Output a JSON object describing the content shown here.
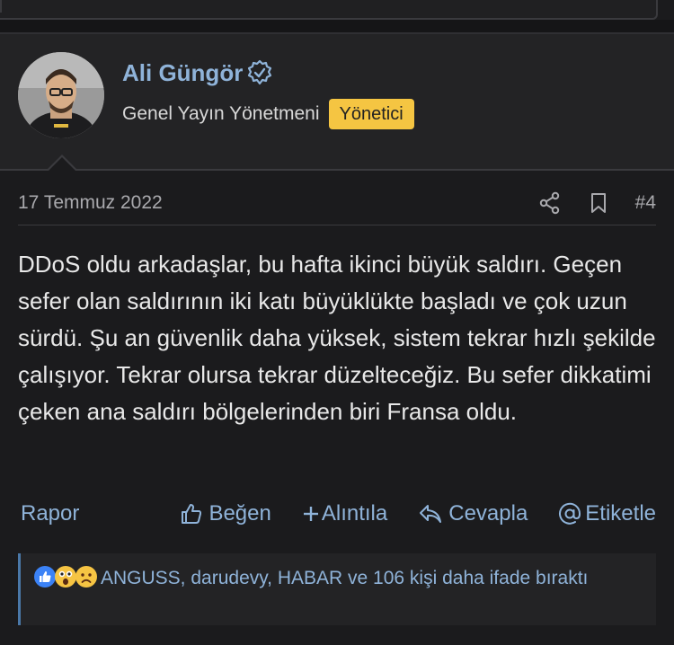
{
  "user": {
    "name": "Ali Güngör",
    "title": "Genel Yayın Yönetmeni",
    "role_badge": "Yönetici"
  },
  "post": {
    "date": "17 Temmuz 2022",
    "number": "#4",
    "body": "DDoS oldu arkadaşlar, bu hafta ikinci büyük saldırı. Geçen sefer olan saldırının iki katı büyüklükte başladı ve çok uzun sürdü. Şu an güvenlik daha yüksek, sistem tekrar hızlı şekilde çalışıyor. Tekrar olursa tekrar düzelteceğiz. Bu sefer dikkatimi çeken ana saldırı bölgelerinden biri Fransa oldu."
  },
  "actions": {
    "report": "Rapor",
    "like": "Beğen",
    "quote": "Alıntıla",
    "reply": "Cevapla",
    "tag": "Etiketle"
  },
  "reactions": {
    "text": "ANGUSS, darudevy, HABAR ve 106 kişi daha ifade bıraktı",
    "icons": [
      "like-reaction-icon",
      "wow-reaction-icon",
      "sad-reaction-icon"
    ]
  },
  "colors": {
    "link": "#8fb3d9",
    "badge": "#f5c542",
    "background": "#1b1b1d"
  }
}
